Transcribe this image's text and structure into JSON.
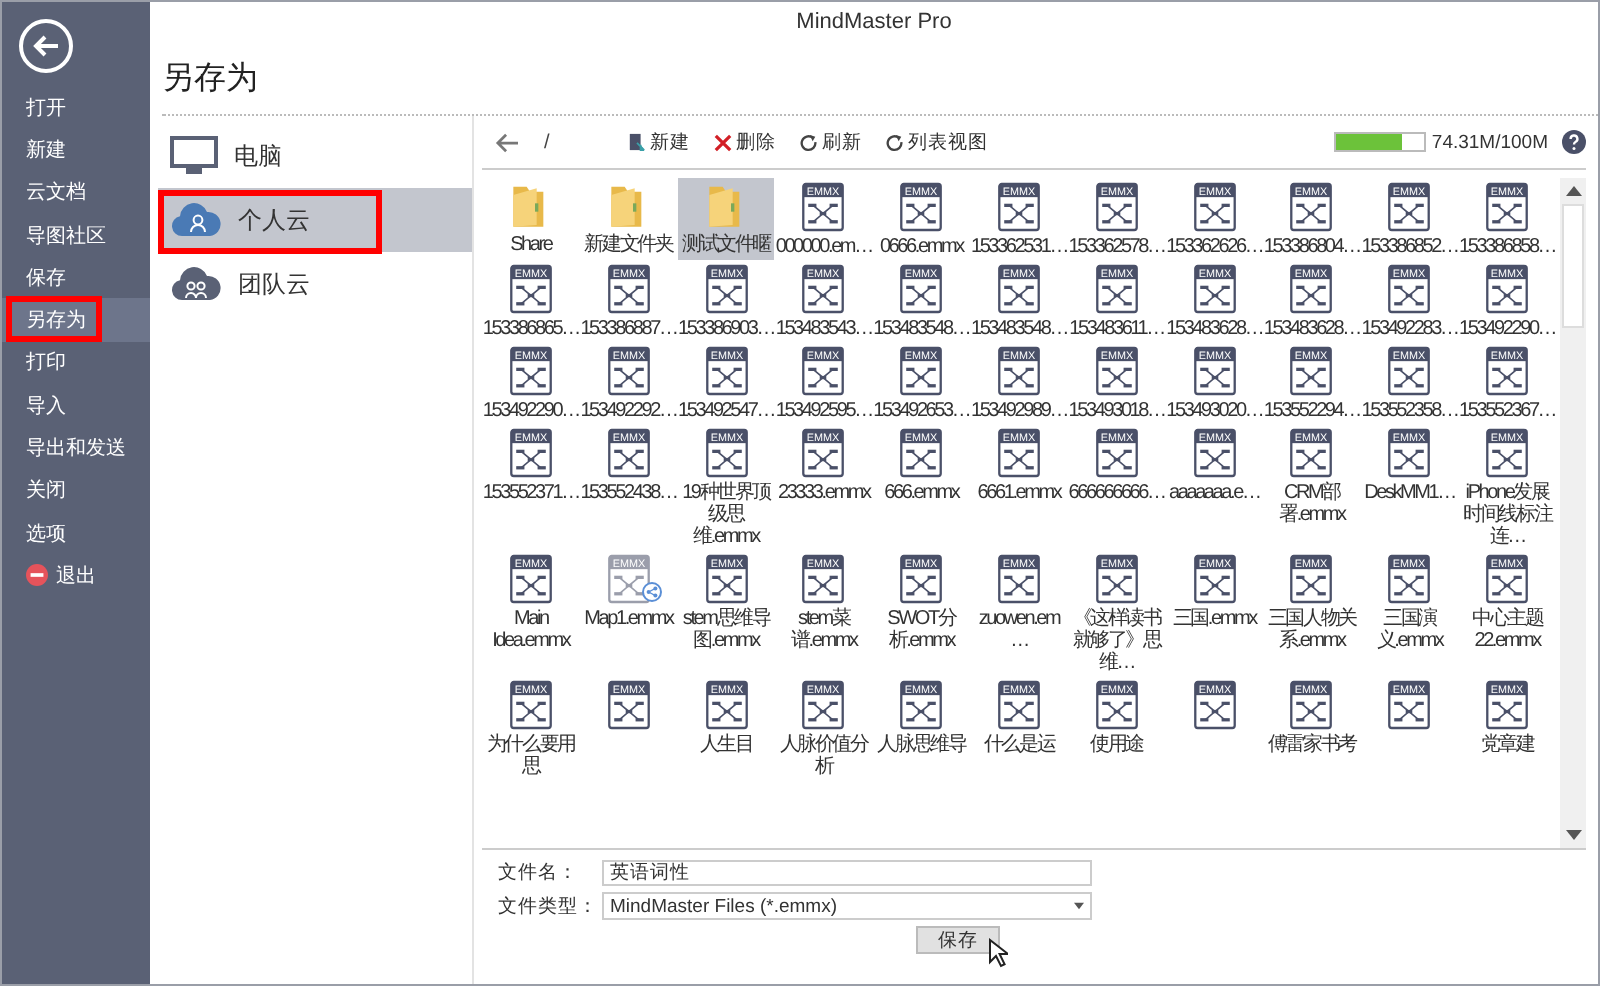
{
  "window": {
    "title": "MindMaster Pro"
  },
  "sidebar": {
    "items": [
      {
        "label": "打开",
        "kind": "plain",
        "selected": false,
        "highlighted": false
      },
      {
        "label": "新建",
        "kind": "plain",
        "selected": false,
        "highlighted": false
      },
      {
        "label": "云文档",
        "kind": "plain",
        "selected": false,
        "highlighted": false
      },
      {
        "label": "导图社区",
        "kind": "plain",
        "selected": false,
        "highlighted": false
      },
      {
        "label": "保存",
        "kind": "plain",
        "selected": false,
        "highlighted": false
      },
      {
        "label": "另存为",
        "kind": "plain",
        "selected": true,
        "highlighted": true
      },
      {
        "label": "打印",
        "kind": "plain",
        "selected": false,
        "highlighted": false
      },
      {
        "label": "导入",
        "kind": "plain",
        "selected": false,
        "highlighted": false
      },
      {
        "label": "导出和发送",
        "kind": "plain",
        "selected": false,
        "highlighted": false
      },
      {
        "label": "关闭",
        "kind": "plain",
        "selected": false,
        "highlighted": false
      },
      {
        "label": "选项",
        "kind": "plain",
        "selected": false,
        "highlighted": false
      },
      {
        "label": "退出",
        "kind": "exit",
        "selected": false,
        "highlighted": false
      }
    ]
  },
  "page_title": "另存为",
  "locations": [
    {
      "label": "电脑",
      "kind": "computer",
      "selected": false,
      "highlighted": false
    },
    {
      "label": "个人云",
      "kind": "personal-cloud",
      "selected": true,
      "highlighted": true
    },
    {
      "label": "团队云",
      "kind": "team-cloud",
      "selected": false,
      "highlighted": false
    }
  ],
  "toolbar": {
    "path": "/",
    "buttons": [
      {
        "label": "新建",
        "kind": "new"
      },
      {
        "label": "删除",
        "kind": "delete"
      },
      {
        "label": "刷新",
        "kind": "refresh"
      },
      {
        "label": "列表视图",
        "kind": "view"
      }
    ]
  },
  "storage": {
    "level": 0.7431,
    "reading": "74.31M/100M"
  },
  "files": [
    {
      "kind": "folder",
      "name": "Share",
      "selected": false
    },
    {
      "kind": "folder",
      "name": "新建文件夹",
      "selected": false
    },
    {
      "kind": "folder",
      "name": "测试文件暱",
      "selected": true
    },
    {
      "kind": "file",
      "name": "000000.em…",
      "badge": "EMMX",
      "selected": false,
      "shared": false
    },
    {
      "kind": "file",
      "name": "0666.emmx",
      "badge": "EMMX",
      "selected": false,
      "shared": false
    },
    {
      "kind": "file",
      "name": "153362531…",
      "badge": "EMMX",
      "selected": false,
      "shared": false
    },
    {
      "kind": "file",
      "name": "153362578…",
      "badge": "EMMX",
      "selected": false,
      "shared": false
    },
    {
      "kind": "file",
      "name": "153362626…",
      "badge": "EMMX",
      "selected": false,
      "shared": false
    },
    {
      "kind": "file",
      "name": "153386804…",
      "badge": "EMMX",
      "selected": false,
      "shared": false
    },
    {
      "kind": "file",
      "name": "153386852…",
      "badge": "EMMX",
      "selected": false,
      "shared": false
    },
    {
      "kind": "file",
      "name": "153386858…",
      "badge": "EMMX",
      "selected": false,
      "shared": false
    },
    {
      "kind": "file",
      "name": "153386865…",
      "badge": "EMMX",
      "selected": false,
      "shared": false
    },
    {
      "kind": "file",
      "name": "153386887…",
      "badge": "EMMX",
      "selected": false,
      "shared": false
    },
    {
      "kind": "file",
      "name": "153386903…",
      "badge": "EMMX",
      "selected": false,
      "shared": false
    },
    {
      "kind": "file",
      "name": "153483543…",
      "badge": "EMMX",
      "selected": false,
      "shared": false
    },
    {
      "kind": "file",
      "name": "153483548…",
      "badge": "EMMX",
      "selected": false,
      "shared": false
    },
    {
      "kind": "file",
      "name": "153483548…",
      "badge": "EMMX",
      "selected": false,
      "shared": false
    },
    {
      "kind": "file",
      "name": "153483611…",
      "badge": "EMMX",
      "selected": false,
      "shared": false
    },
    {
      "kind": "file",
      "name": "153483628…",
      "badge": "EMMX",
      "selected": false,
      "shared": false
    },
    {
      "kind": "file",
      "name": "153483628…",
      "badge": "EMMX",
      "selected": false,
      "shared": false
    },
    {
      "kind": "file",
      "name": "153492283…",
      "badge": "EMMX",
      "selected": false,
      "shared": false
    },
    {
      "kind": "file",
      "name": "153492290…",
      "badge": "EMMX",
      "selected": false,
      "shared": false
    },
    {
      "kind": "file",
      "name": "153492290…",
      "badge": "EMMX",
      "selected": false,
      "shared": false
    },
    {
      "kind": "file",
      "name": "153492292…",
      "badge": "EMMX",
      "selected": false,
      "shared": false
    },
    {
      "kind": "file",
      "name": "153492547…",
      "badge": "EMMX",
      "selected": false,
      "shared": false
    },
    {
      "kind": "file",
      "name": "153492595…",
      "badge": "EMMX",
      "selected": false,
      "shared": false
    },
    {
      "kind": "file",
      "name": "153492653…",
      "badge": "EMMX",
      "selected": false,
      "shared": false
    },
    {
      "kind": "file",
      "name": "153492989…",
      "badge": "EMMX",
      "selected": false,
      "shared": false
    },
    {
      "kind": "file",
      "name": "153493018…",
      "badge": "EMMX",
      "selected": false,
      "shared": false
    },
    {
      "kind": "file",
      "name": "153493020…",
      "badge": "EMMX",
      "selected": false,
      "shared": false
    },
    {
      "kind": "file",
      "name": "153552294…",
      "badge": "EMMX",
      "selected": false,
      "shared": false
    },
    {
      "kind": "file",
      "name": "153552358…",
      "badge": "EMMX",
      "selected": false,
      "shared": false
    },
    {
      "kind": "file",
      "name": "153552367…",
      "badge": "EMMX",
      "selected": false,
      "shared": false
    },
    {
      "kind": "file",
      "name": "153552371…",
      "badge": "EMMX",
      "selected": false,
      "shared": false
    },
    {
      "kind": "file",
      "name": "153552438…",
      "badge": "EMMX",
      "selected": false,
      "shared": false
    },
    {
      "kind": "file",
      "name": "19种世界顶级思维.emmx",
      "badge": "EMMX",
      "selected": false,
      "shared": false
    },
    {
      "kind": "file",
      "name": "23333.emmx",
      "badge": "EMMX",
      "selected": false,
      "shared": false
    },
    {
      "kind": "file",
      "name": "666.emmx",
      "badge": "EMMX",
      "selected": false,
      "shared": false
    },
    {
      "kind": "file",
      "name": "6661.emmx",
      "badge": "EMMX",
      "selected": false,
      "shared": false
    },
    {
      "kind": "file",
      "name": "666666666…",
      "badge": "EMMX",
      "selected": false,
      "shared": false
    },
    {
      "kind": "file",
      "name": "aaaaaaa.e…",
      "badge": "EMMX",
      "selected": false,
      "shared": false
    },
    {
      "kind": "file",
      "name": "CRM部署.emmx",
      "badge": "EMMX",
      "selected": false,
      "shared": false
    },
    {
      "kind": "file",
      "name": "DeskMM1…",
      "badge": "EMMX",
      "selected": false,
      "shared": false
    },
    {
      "kind": "file",
      "name": "iPhone发展时间线标注连…",
      "badge": "EMMX",
      "selected": false,
      "shared": false
    },
    {
      "kind": "file",
      "name": "Main Idea.emmx",
      "badge": "EMMX",
      "selected": false,
      "shared": false
    },
    {
      "kind": "file",
      "name": "Map1.emmx",
      "badge": "EMMX",
      "selected": false,
      "shared": true
    },
    {
      "kind": "file",
      "name": "stem思维导图.emmx",
      "badge": "EMMX",
      "selected": false,
      "shared": false
    },
    {
      "kind": "file",
      "name": "stem菜谱.emmx",
      "badge": "EMMX",
      "selected": false,
      "shared": false
    },
    {
      "kind": "file",
      "name": "SWOT分析.emmx",
      "badge": "EMMX",
      "selected": false,
      "shared": false
    },
    {
      "kind": "file",
      "name": "zuowen.em…",
      "badge": "EMMX",
      "selected": false,
      "shared": false
    },
    {
      "kind": "file",
      "name": "《这样读书就够了》思维…",
      "badge": "EMMX",
      "selected": false,
      "shared": false
    },
    {
      "kind": "file",
      "name": "三国.emmx",
      "badge": "EMMX",
      "selected": false,
      "shared": false
    },
    {
      "kind": "file",
      "name": "三国人物关系.emmx",
      "badge": "EMMX",
      "selected": false,
      "shared": false
    },
    {
      "kind": "file",
      "name": "三国演义.emmx",
      "badge": "EMMX",
      "selected": false,
      "shared": false
    },
    {
      "kind": "file",
      "name": "中心主题22.emmx",
      "badge": "EMMX",
      "selected": false,
      "shared": false
    },
    {
      "kind": "file",
      "name": "为什么要用思",
      "badge": "EMMX",
      "selected": false,
      "shared": false
    },
    {
      "kind": "file",
      "badge": "EMMX",
      "selected": false,
      "shared": false
    },
    {
      "kind": "file",
      "name": "人生目",
      "badge": "EMMX",
      "selected": false,
      "shared": false
    },
    {
      "kind": "file",
      "name": "人脉价值分析",
      "badge": "EMMX",
      "selected": false,
      "shared": false
    },
    {
      "kind": "file",
      "name": "人脉思维导",
      "badge": "EMMX",
      "selected": false,
      "shared": false
    },
    {
      "kind": "file",
      "name": "什么是运",
      "badge": "EMMX",
      "selected": false,
      "shared": false
    },
    {
      "kind": "file",
      "name": "使用途",
      "badge": "EMMX",
      "selected": false,
      "shared": false
    },
    {
      "kind": "file",
      "badge": "EMMX",
      "selected": false,
      "shared": false
    },
    {
      "kind": "file",
      "name": "傅雷家书考",
      "badge": "EMMX",
      "selected": false,
      "shared": false
    },
    {
      "kind": "file",
      "badge": "EMMX",
      "selected": false,
      "shared": false
    },
    {
      "kind": "file",
      "name": "党章建",
      "badge": "EMMX",
      "selected": false,
      "shared": false
    }
  ],
  "form": {
    "file_name_label": "文件名：",
    "file_name": "英语词性",
    "file_type_label": "文件类型：",
    "file_type": "MindMaster Files (*.emmx)",
    "save_button": "保存"
  }
}
